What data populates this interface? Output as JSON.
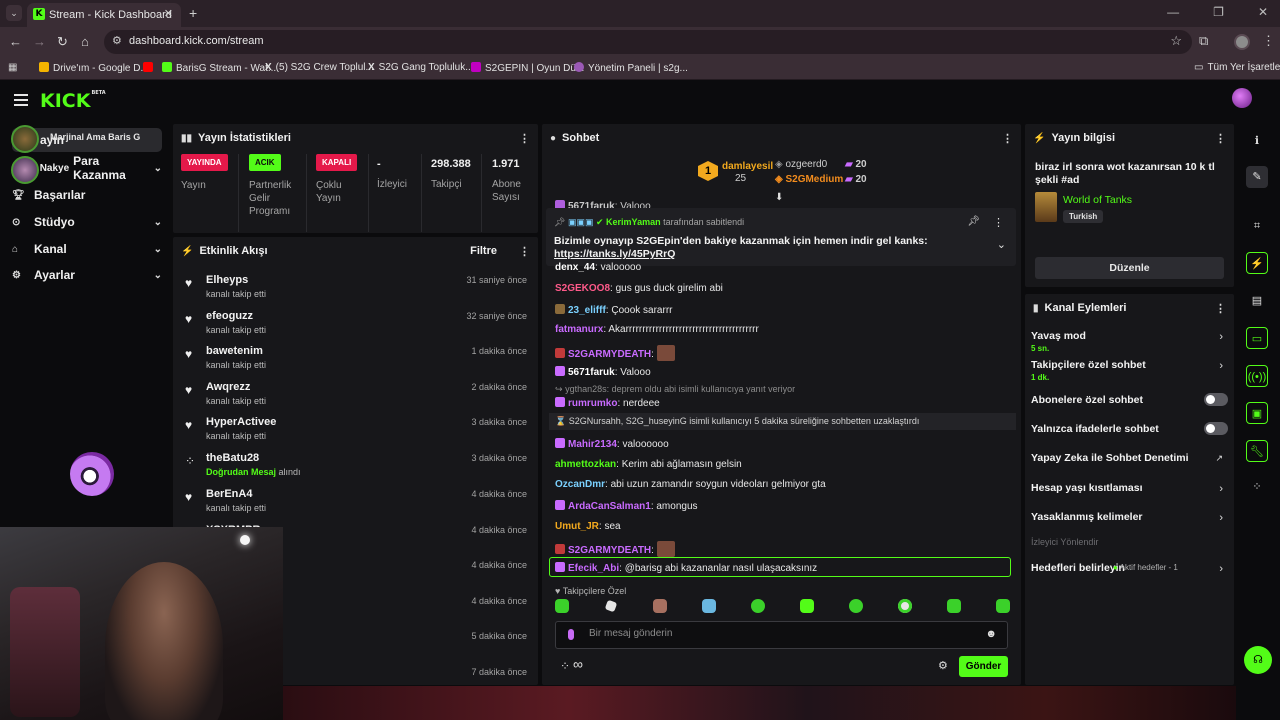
{
  "browser": {
    "tab_title": "Stream - Kick Dashboard",
    "url": "dashboard.kick.com/stream",
    "bookmarks": [
      {
        "label": "Drive'ım - Google D...",
        "color": "#f4b400"
      },
      {
        "label": "BarisG Stream - Wat...",
        "color": "#ff0000"
      },
      {
        "label": "BarisG Stream - Wat...",
        "color": "#53fc18"
      },
      {
        "label": "(5) S2G Crew Toplul...",
        "color": "#ffffff"
      },
      {
        "label": "S2G Gang Topluluk...",
        "color": "#ffffff"
      },
      {
        "label": "S2GEPIN | Oyun Dü...",
        "color": "#c000c0"
      },
      {
        "label": "Yönetim Paneli | s2g...",
        "color": "#9b59b6"
      }
    ],
    "all_bookmarks": "Tüm Yer İşaretleri"
  },
  "app": {
    "logo": "KICK",
    "logo_beta": "BETA",
    "accent": "#53fc18"
  },
  "sidebar": {
    "float_tooltip": "Marjinal Ama Baris G",
    "items": [
      {
        "label": "Yayın",
        "icon": "broadcast-icon"
      },
      {
        "label": "Para Kazanma",
        "icon": "money-icon"
      },
      {
        "label": "Başarılar",
        "icon": "trophy-icon"
      },
      {
        "label": "Stüdyo",
        "icon": "studio-icon"
      },
      {
        "label": "Kanal",
        "icon": "channel-icon"
      },
      {
        "label": "Ayarlar",
        "icon": "gear-icon"
      }
    ],
    "overlay_labels": [
      "ayın",
      "Nakye"
    ]
  },
  "stream_stats": {
    "title": "Yayın İstatistikleri",
    "stats": [
      {
        "badge": "YAYINDA",
        "label": "Yayın"
      },
      {
        "badge": "ACIK",
        "label": "Partnerlik Gelir Programı"
      },
      {
        "badge": "KAPALI",
        "label": "Çoklu Yayın"
      },
      {
        "value": "-",
        "label": "İzleyici"
      },
      {
        "value": "298.388",
        "label": "Takipçi"
      },
      {
        "value": "1.971",
        "label": "Abone Sayısı"
      }
    ]
  },
  "activity": {
    "title": "Etkinlik Akışı",
    "filter": "Filtre",
    "events": [
      {
        "name": "Elheyps",
        "action": "kanalı takip etti",
        "time": "31 saniye önce"
      },
      {
        "name": "efeoguzz",
        "action": "kanalı takip etti",
        "time": "32 saniye önce"
      },
      {
        "name": "bawetenim",
        "action": "kanalı takip etti",
        "time": "1 dakika önce"
      },
      {
        "name": "Awqrezz",
        "action": "kanalı takip etti",
        "time": "2 dakika önce"
      },
      {
        "name": "HyperActivee",
        "action": "kanalı takip etti",
        "time": "3 dakika önce"
      },
      {
        "name": "theBatu28",
        "action_hl": "Doğrudan Mesaj",
        "action": "alındı",
        "time": "3 dakika önce"
      },
      {
        "name": "BerEnA4",
        "action": "kanalı takip etti",
        "time": "4 dakika önce"
      },
      {
        "name": "XSXRMPR",
        "action": "",
        "time": "4 dakika önce"
      },
      {
        "name": "",
        "action": "",
        "time": "4 dakika önce"
      },
      {
        "name": "",
        "action": "",
        "time": "4 dakika önce"
      },
      {
        "name": "",
        "action": "",
        "time": "5 dakika önce"
      },
      {
        "name": "",
        "action": "",
        "time": "7 dakika önce"
      }
    ]
  },
  "chat": {
    "title": "Sohbet",
    "top_viewers": [
      {
        "name": "damlayesil",
        "count": "25",
        "color": "#f2a91e"
      },
      {
        "name": "ozgeerd0",
        "count": "20",
        "color": "#cfcfcf"
      },
      {
        "name": "S2GMedium",
        "count": "20",
        "color": "#f28c1e"
      }
    ],
    "crown_rank": "1",
    "pinned": {
      "by": "KerimYaman",
      "by_suffix": "tarafından sabitlendi",
      "text": "Bizimle oynayıp S2GEpin'den bakiye kazanmak için hemen indir gel kanks:",
      "link": "https://tanks.ly/45PyRrQ"
    },
    "messages": [
      {
        "user": "5671faruk",
        "text": "Valooo",
        "color": "#ffffff"
      },
      {
        "user": "denx_44",
        "text": "valooooo",
        "color": "#ffffff"
      },
      {
        "user": "S2GEKOO8",
        "text": "gus gus duck girelim abi",
        "color": "#ff5a8a"
      },
      {
        "user": "23_elifff",
        "text": "Çoook sararrr",
        "color": "#7bd1ff"
      },
      {
        "user": "fatmanurx",
        "text": "Akarrrrrrrrrrrrrrrrrrrrrrrrrrrrrrrrrrrrrrrr",
        "color": "#c96bff"
      },
      {
        "user": "S2GARMYDEATH",
        "text": "",
        "color": "#c96bff"
      },
      {
        "user": "5671faruk",
        "text": "Valooo",
        "color": "#ffffff"
      },
      {
        "user": "rumrumko",
        "text": "nerdeee",
        "color": "#c96bff"
      },
      {
        "user": "Mahir2134",
        "text": "valoooooo",
        "color": "#c96bff"
      },
      {
        "user": "ahmettozkan",
        "text": "Kerim abi ağlamasın gelsin",
        "color": "#53fc18"
      },
      {
        "user": "OzcanDmr",
        "text": "abi uzun zamandır soygun videoları gelmiyor gta",
        "color": "#7bd1ff"
      },
      {
        "user": "ArdaCanSalman1",
        "text": "amongus",
        "color": "#c96bff"
      },
      {
        "user": "Umut_JR",
        "text": "sea",
        "color": "#f2a91e"
      },
      {
        "user": "S2GARMYDEATH",
        "text": "",
        "color": "#c96bff"
      },
      {
        "user": "Efecik_Abi",
        "text": "@barisg abi kazananlar nasıl ulaşacaksınız",
        "color": "#c96bff"
      }
    ],
    "reply_note": "ygthan28s: deprem oldu abi isimli kullanıcıya yanıt veriyor",
    "system_message": "S2GNursahh, S2G_huseyinG isimli kullanıcıyı 5 dakika süreliğine sohbetten uzaklaştırdı",
    "followers_only": "Takipçilere Özel",
    "input_placeholder": "Bir mesaj gönderin",
    "send_label": "Gönder",
    "infinity": "∞"
  },
  "stream_info": {
    "title": "Yayın bilgisi",
    "stream_title": "biraz irl sonra wot kazanırsan 10 k tl şekli #ad",
    "category": "World of Tanks",
    "language": "Turkish",
    "edit_label": "Düzenle"
  },
  "channel_actions": {
    "title": "Kanal Eylemleri",
    "items": [
      {
        "label": "Yavaş mod",
        "sub": "5 sn.",
        "kind": "chevron"
      },
      {
        "label": "Takipçilere özel sohbet",
        "sub": "1 dk.",
        "kind": "chevron"
      },
      {
        "label": "Abonelere özel sohbet",
        "kind": "toggle"
      },
      {
        "label": "Yalnızca ifadelerle sohbet",
        "kind": "toggle"
      },
      {
        "label": "Yapay Zeka ile Sohbet Denetimi",
        "kind": "external"
      },
      {
        "label": "Hesap yaşı kısıtlaması",
        "kind": "chevron"
      },
      {
        "label": "Yasaklanmış kelimeler",
        "kind": "chevron"
      }
    ],
    "section_label": "İzleyici Yönlendir",
    "goals_label": "Hedefleri belirleyin",
    "goals_status": "Aktif hedefler - 1"
  }
}
